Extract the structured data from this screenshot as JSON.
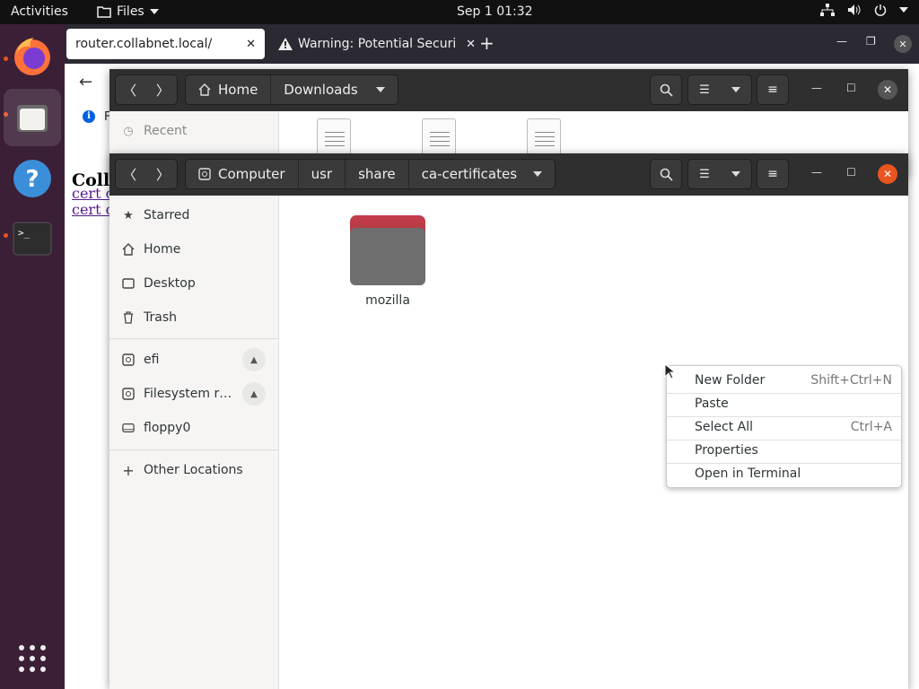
{
  "topbar": {
    "activities": "Activities",
    "app_name": "Files",
    "clock": "Sep 1  01:32"
  },
  "firefox": {
    "tab_active": "router.collabnet.local/",
    "tab_inactive": "Warning: Potential Securi",
    "info_text": "F",
    "heading": "Coll",
    "links": [
      "cert c",
      "cert c"
    ]
  },
  "downloads_window": {
    "path": [
      "Home",
      "Downloads"
    ],
    "sidebar_first": "Recent"
  },
  "files_window": {
    "path": [
      "Computer",
      "usr",
      "share",
      "ca-certificates"
    ],
    "sidebar": {
      "starred": "Starred",
      "home": "Home",
      "desktop": "Desktop",
      "trash": "Trash",
      "efi": "efi",
      "filesystem": "Filesystem r…",
      "floppy": "floppy0",
      "other": "Other Locations"
    },
    "folder_name": "mozilla"
  },
  "context_menu": {
    "new_folder": "New Folder",
    "new_folder_accel": "Shift+Ctrl+N",
    "paste": "Paste",
    "select_all": "Select All",
    "select_all_accel": "Ctrl+A",
    "properties": "Properties",
    "open_terminal": "Open in Terminal"
  },
  "colors": {
    "ubuntu_orange": "#e95420",
    "headerbar": "#2f2f2f",
    "dock": "#3b1f36"
  }
}
